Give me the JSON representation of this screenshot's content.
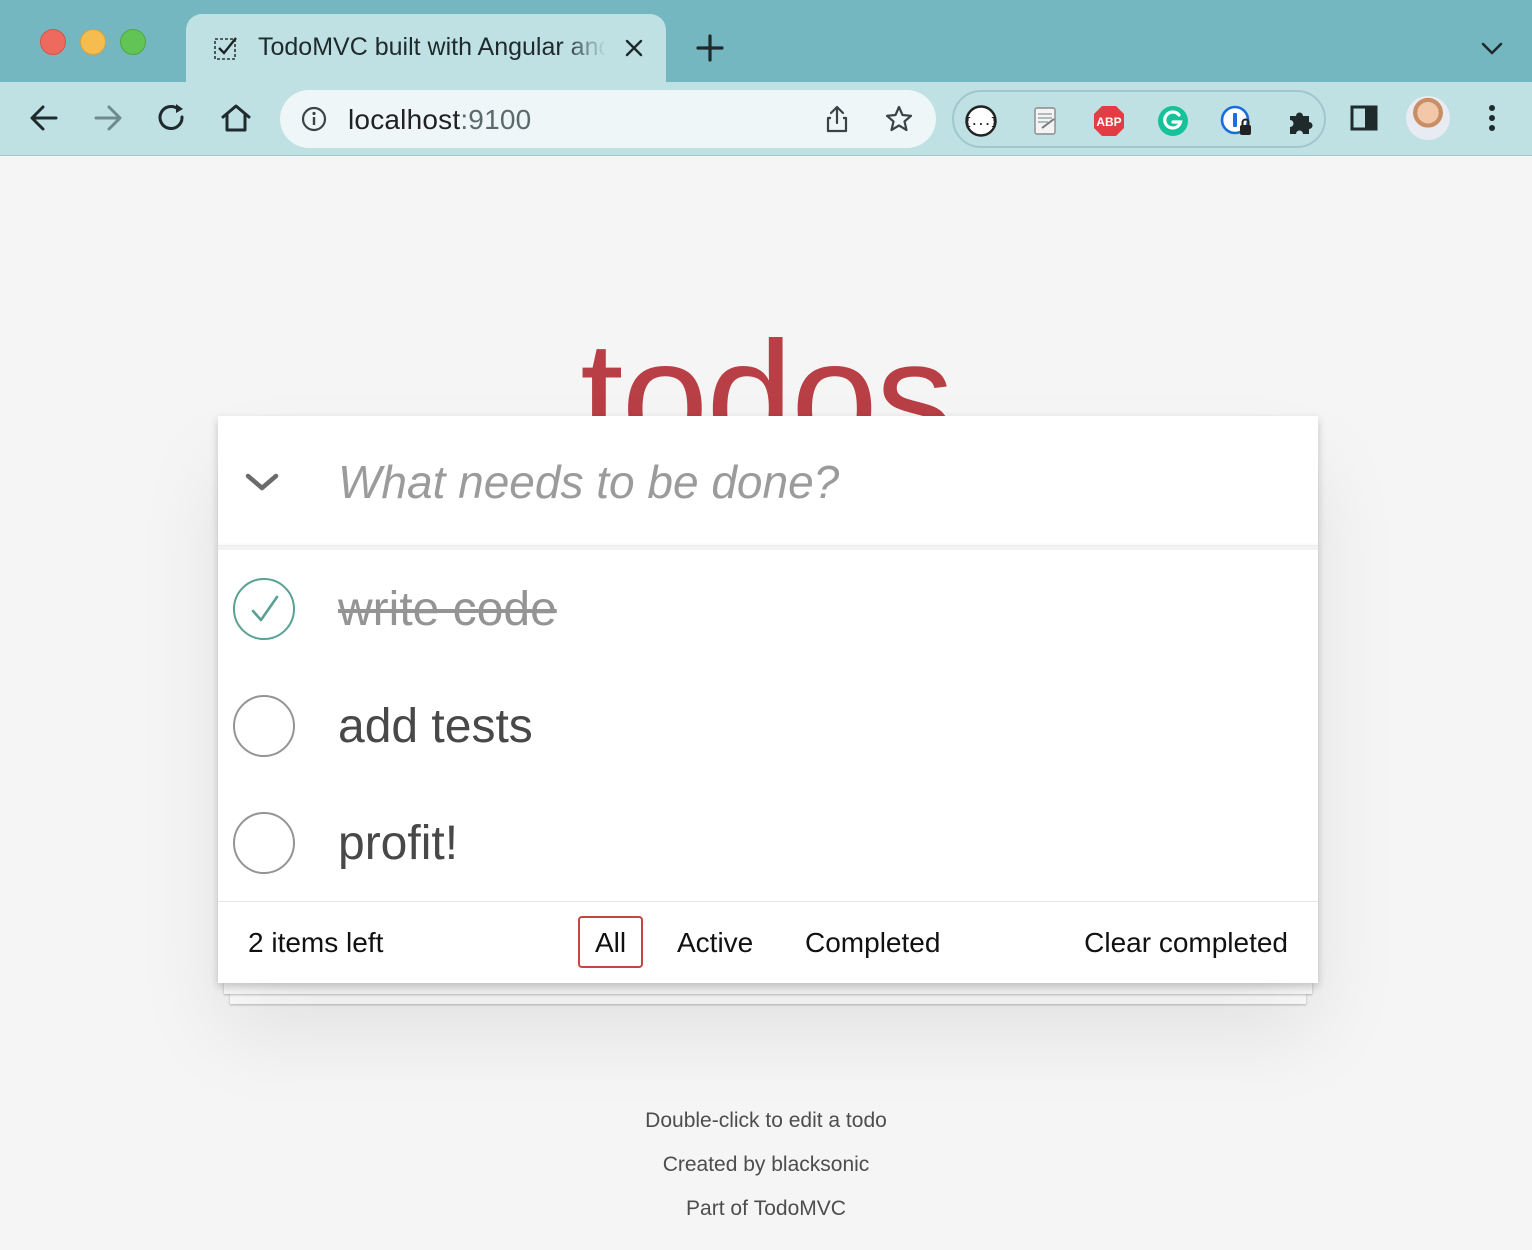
{
  "browser": {
    "tab_title": "TodoMVC built with Angular and",
    "url_host": "localhost",
    "url_port": ":9100",
    "extensions": [
      "json-viewer-icon",
      "notepad-icon",
      "adblock-plus-icon",
      "grammarly-icon",
      "password-manager-icon",
      "extensions-puzzle-icon"
    ],
    "extension_labels": {
      "adblock": "ABP",
      "json": "{...}"
    },
    "colors": {
      "titlebar": "#74b7c0",
      "toolbar": "#bfe1e4",
      "omnibox": "#eef6f7"
    }
  },
  "app": {
    "title": "todos",
    "title_color": "#b83f45",
    "new_todo_placeholder": "What needs to be done?",
    "todos": [
      {
        "label": "write code",
        "completed": true
      },
      {
        "label": "add tests",
        "completed": false
      },
      {
        "label": "profit!",
        "completed": false
      }
    ],
    "footer": {
      "count": "2 items left",
      "filters": [
        {
          "label": "All",
          "selected": true
        },
        {
          "label": "Active",
          "selected": false
        },
        {
          "label": "Completed",
          "selected": false
        }
      ],
      "clear_completed": "Clear completed"
    }
  },
  "info": {
    "hint": "Double-click to edit a todo",
    "created_by_prefix": "Created by ",
    "created_by_link": "blacksonic",
    "part_of_prefix": "Part of ",
    "part_of_link": "TodoMVC"
  }
}
